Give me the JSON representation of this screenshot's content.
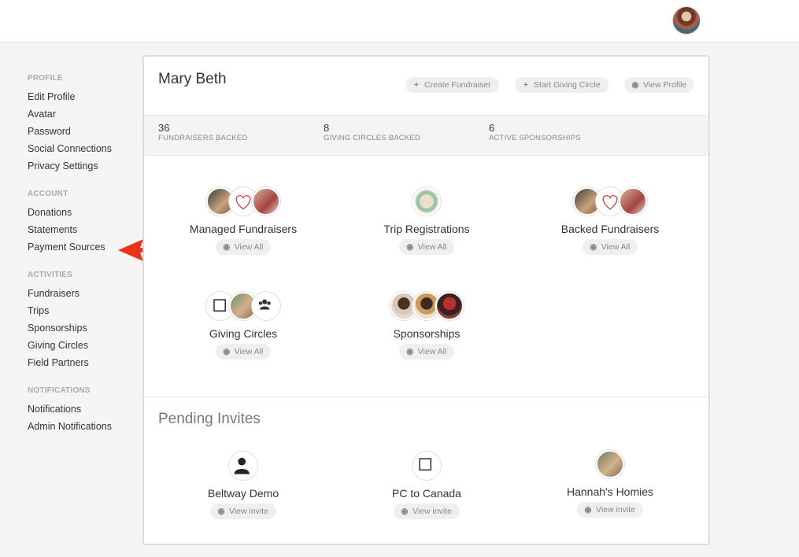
{
  "topbar": {
    "avatar_icon": "user-avatar"
  },
  "sidebar": {
    "sections": [
      {
        "title": "PROFILE",
        "items": [
          "Edit Profile",
          "Avatar",
          "Password",
          "Social Connections",
          "Privacy Settings"
        ]
      },
      {
        "title": "ACCOUNT",
        "items": [
          "Donations",
          "Statements",
          "Payment Sources"
        ]
      },
      {
        "title": "ACTIVITIES",
        "items": [
          "Fundraisers",
          "Trips",
          "Sponsorships",
          "Giving Circles",
          "Field Partners"
        ]
      },
      {
        "title": "NOTIFICATIONS",
        "items": [
          "Notifications",
          "Admin Notifications"
        ]
      }
    ]
  },
  "annotation": {
    "arrow_color": "#e8341c",
    "arrow_icon": "red-arrow-left"
  },
  "profile": {
    "name": "Mary Beth",
    "actions": {
      "create_fundraiser": "Create Fundraiser",
      "start_giving_circle": "Start Giving Circle",
      "view_profile": "View Profile"
    },
    "stats": [
      {
        "value": "36",
        "label": "FUNDRAISERS BACKED"
      },
      {
        "value": "8",
        "label": "GIVING CIRCLES BACKED"
      },
      {
        "value": "6",
        "label": "ACTIVE SPONSORSHIPS"
      }
    ],
    "tiles": [
      {
        "title": "Managed Fundraisers",
        "action": "View All"
      },
      {
        "title": "Trip Registrations",
        "action": "View All"
      },
      {
        "title": "Backed Fundraisers",
        "action": "View All"
      },
      {
        "title": "Giving Circles",
        "action": "View All"
      },
      {
        "title": "Sponsorships",
        "action": "View All"
      }
    ]
  },
  "pending": {
    "title": "Pending Invites",
    "invites": [
      {
        "title": "Beltway Demo",
        "action": "View invite"
      },
      {
        "title": "PC to Canada",
        "action": "View invite"
      },
      {
        "title": "Hannah's Homies",
        "action": "View invite"
      }
    ]
  }
}
